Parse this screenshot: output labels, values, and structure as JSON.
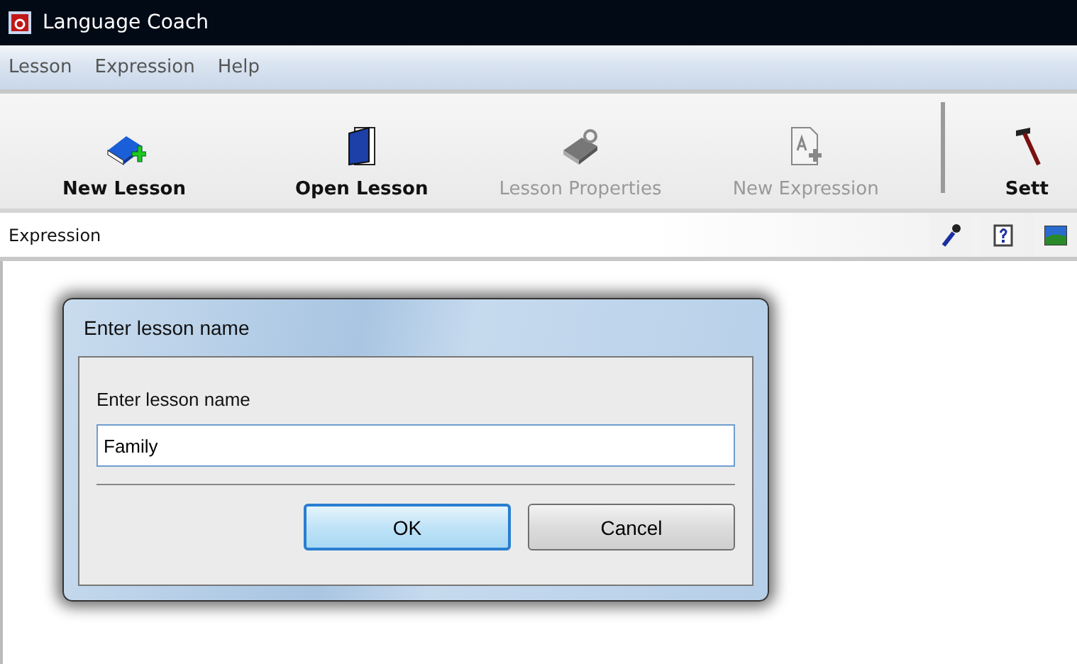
{
  "window": {
    "title": "Language Coach"
  },
  "menu": [
    "Lesson",
    "Expression",
    "Help"
  ],
  "toolbar": [
    {
      "kind": "button",
      "label": "New Lesson",
      "disabled": false
    },
    {
      "kind": "button",
      "label": "Open Lesson",
      "disabled": false
    },
    {
      "kind": "button",
      "label": "Lesson Properties",
      "disabled": true
    },
    {
      "kind": "button",
      "label": "New Expression",
      "disabled": true
    },
    {
      "kind": "separator"
    },
    {
      "kind": "button",
      "label": "Sett",
      "disabled": false
    }
  ],
  "panel": {
    "title": "Expression"
  },
  "dialog": {
    "title": "Enter lesson name",
    "label": "Enter lesson name",
    "value": "Family",
    "buttons": [
      {
        "label": "OK",
        "default": true
      },
      {
        "label": "Cancel",
        "default": false
      }
    ]
  }
}
